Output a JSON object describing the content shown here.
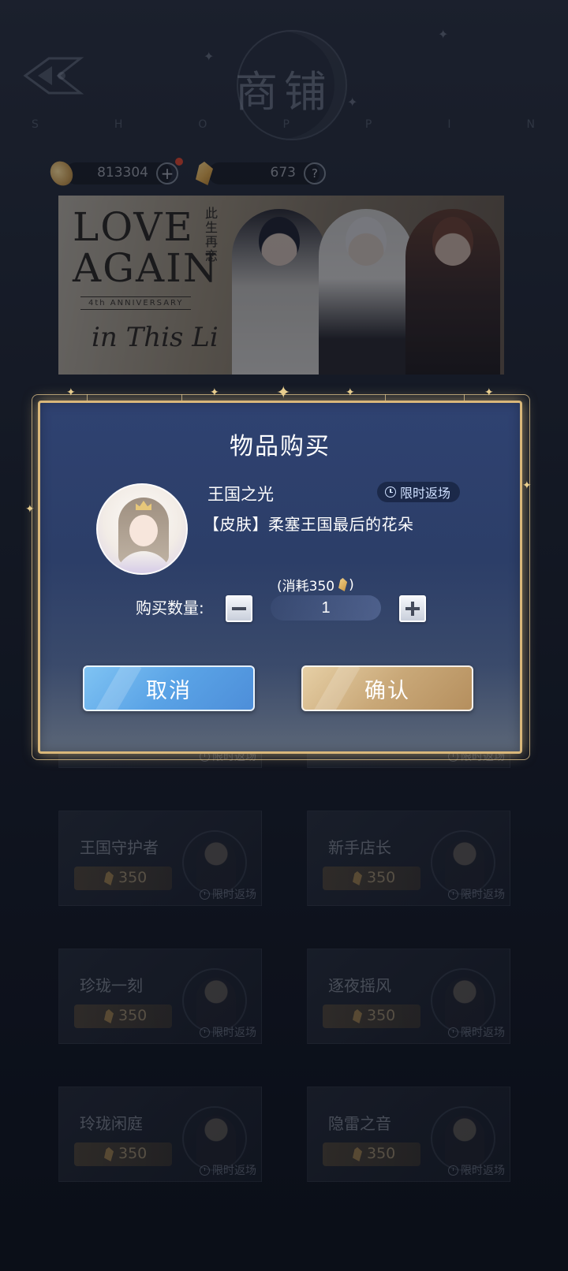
{
  "header": {
    "title": "商铺",
    "subtitle_letters": [
      "S",
      "H",
      "O",
      "P",
      "P",
      "I",
      "N"
    ]
  },
  "currency": {
    "coins": "813304",
    "gems": "673"
  },
  "banner": {
    "title": "LOVE AGAIN",
    "cn_title": "此生再恋",
    "anniversary": "4th ANNIVERSARY",
    "script": "in This Li"
  },
  "products": [
    {
      "name": "王国守护者",
      "price": "350",
      "tag": "限时返场"
    },
    {
      "name": "新手店长",
      "price": "350",
      "tag": "限时返场"
    },
    {
      "name": "珍珑一刻",
      "price": "350",
      "tag": "限时返场"
    },
    {
      "name": "逐夜摇风",
      "price": "350",
      "tag": "限时返场"
    },
    {
      "name": "玲珑闲庭",
      "price": "350",
      "tag": "限时返场"
    },
    {
      "name": "隐雷之音",
      "price": "350",
      "tag": "限时返场"
    }
  ],
  "hidden_tags": [
    "限时返场",
    "限时返场"
  ],
  "dialog": {
    "title": "物品购买",
    "item_name": "王国之光",
    "limit_badge": "限时返场",
    "item_desc": "【皮肤】柔塞王国最后的花朵",
    "cost_label": "(消耗350",
    "cost_close": ")",
    "qty_label": "购买数量:",
    "quantity": "1",
    "cancel_label": "取消",
    "confirm_label": "确认"
  },
  "colors": {
    "dialog_border": "#d9b77a",
    "cancel_button": "#5aa3e6",
    "confirm_button": "#c9a878"
  }
}
